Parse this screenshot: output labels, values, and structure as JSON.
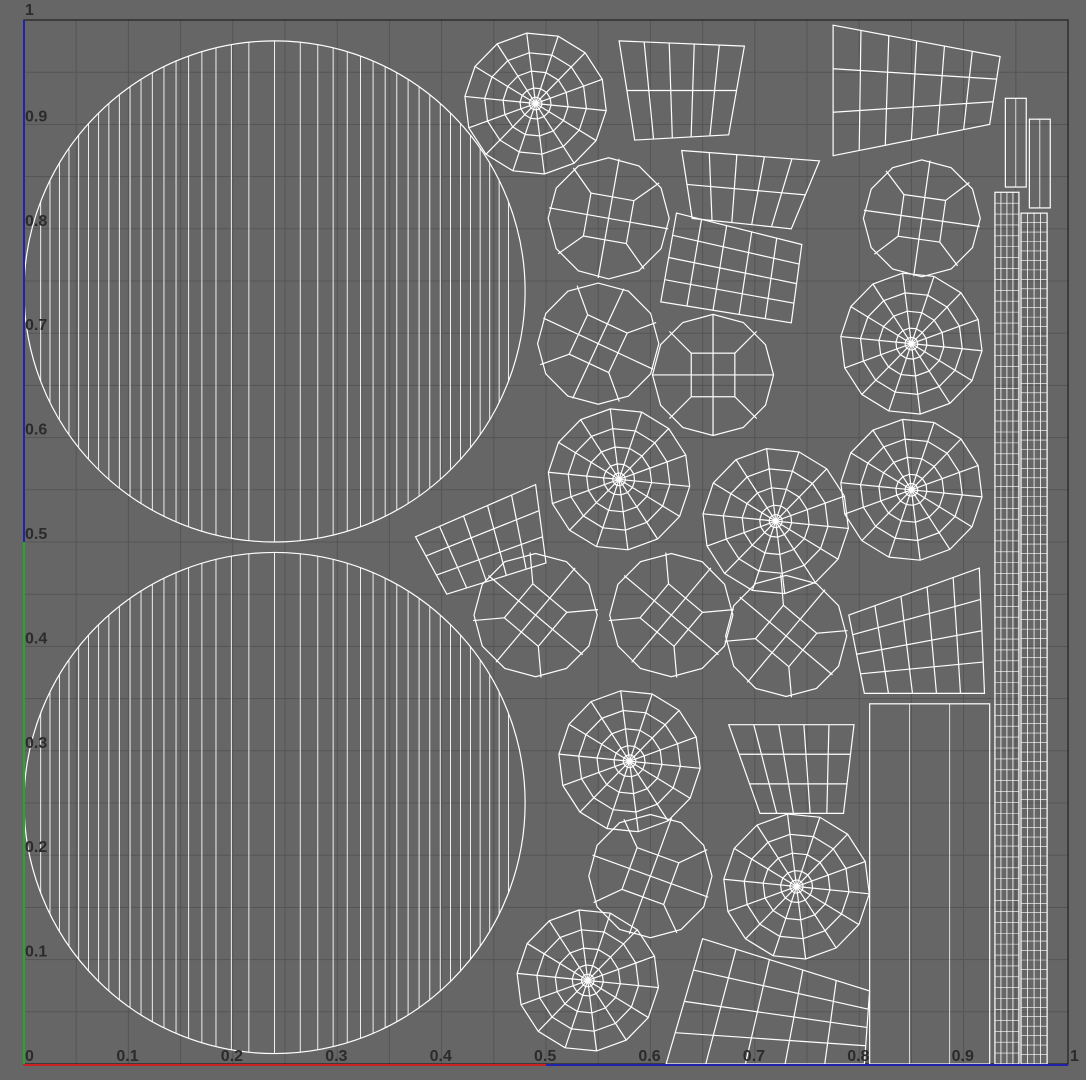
{
  "viewport": {
    "background": "#666666",
    "grid_color": "#555555",
    "line_color": "#ffffff",
    "border_color": "#222222",
    "u_axis_color": "#cc2222",
    "v_axis_color": "#2222aa",
    "v_axis_lower_color": "#22aa22"
  },
  "axes": {
    "u_ticks": [
      "0",
      "0.1",
      "0.2",
      "0.3",
      "0.4",
      "0.5",
      "0.6",
      "0.7",
      "0.8",
      "0.9",
      "1"
    ],
    "v_ticks": [
      "0.1",
      "0.2",
      "0.3",
      "0.4",
      "0.5",
      "0.6",
      "0.7",
      "0.8",
      "0.9",
      "1"
    ]
  },
  "uv_islands": {
    "large_disks": [
      {
        "name": "uv-island-large-disk-top",
        "u": 0.24,
        "v": 0.74,
        "r": 0.24,
        "stripes": 40
      },
      {
        "name": "uv-island-large-disk-bottom",
        "u": 0.24,
        "v": 0.25,
        "r": 0.24,
        "stripes": 40
      }
    ],
    "radial_caps": [
      {
        "name": "uv-island-cap-1",
        "u": 0.49,
        "v": 0.92,
        "r": 0.068,
        "sides": 14
      },
      {
        "name": "uv-island-cap-2",
        "u": 0.57,
        "v": 0.56,
        "r": 0.068,
        "sides": 14
      },
      {
        "name": "uv-island-cap-3",
        "u": 0.72,
        "v": 0.52,
        "r": 0.07,
        "sides": 14
      },
      {
        "name": "uv-island-cap-4",
        "u": 0.85,
        "v": 0.69,
        "r": 0.068,
        "sides": 14
      },
      {
        "name": "uv-island-cap-5",
        "u": 0.85,
        "v": 0.55,
        "r": 0.068,
        "sides": 14
      },
      {
        "name": "uv-island-cap-6",
        "u": 0.58,
        "v": 0.29,
        "r": 0.068,
        "sides": 14
      },
      {
        "name": "uv-island-cap-7",
        "u": 0.74,
        "v": 0.17,
        "r": 0.07,
        "sides": 14
      },
      {
        "name": "uv-island-cap-8",
        "u": 0.54,
        "v": 0.08,
        "r": 0.068,
        "sides": 14
      }
    ],
    "quad_caps": [
      {
        "name": "uv-island-quad-cap-1",
        "u": 0.56,
        "v": 0.81,
        "r": 0.058,
        "rot": 10
      },
      {
        "name": "uv-island-quad-cap-2",
        "u": 0.55,
        "v": 0.69,
        "r": 0.058,
        "rot": 25
      },
      {
        "name": "uv-island-quad-cap-3",
        "u": 0.66,
        "v": 0.66,
        "r": 0.058,
        "rot": 0
      },
      {
        "name": "uv-island-quad-cap-4",
        "u": 0.86,
        "v": 0.81,
        "r": 0.056,
        "rot": 8
      },
      {
        "name": "uv-island-quad-cap-5",
        "u": 0.49,
        "v": 0.43,
        "r": 0.059,
        "rot": 40
      },
      {
        "name": "uv-island-quad-cap-6",
        "u": 0.62,
        "v": 0.43,
        "r": 0.059,
        "rot": 40
      },
      {
        "name": "uv-island-quad-cap-7",
        "u": 0.73,
        "v": 0.41,
        "r": 0.058,
        "rot": 40
      },
      {
        "name": "uv-island-quad-cap-8",
        "u": 0.6,
        "v": 0.18,
        "r": 0.059,
        "rot": 20
      }
    ],
    "ring_strips": [
      {
        "name": "uv-island-strip-1",
        "pts": [
          [
            0.57,
            0.98
          ],
          [
            0.69,
            0.975
          ],
          [
            0.675,
            0.89
          ],
          [
            0.585,
            0.885
          ]
        ],
        "cols": 5,
        "rows": 2
      },
      {
        "name": "uv-island-strip-2",
        "pts": [
          [
            0.775,
            0.995
          ],
          [
            0.935,
            0.965
          ],
          [
            0.925,
            0.9
          ],
          [
            0.775,
            0.87
          ]
        ],
        "cols": 6,
        "rows": 3
      },
      {
        "name": "uv-island-strip-3",
        "pts": [
          [
            0.63,
            0.875
          ],
          [
            0.762,
            0.865
          ],
          [
            0.735,
            0.8
          ],
          [
            0.64,
            0.81
          ]
        ],
        "cols": 5,
        "rows": 2
      },
      {
        "name": "uv-island-strip-4",
        "pts": [
          [
            0.625,
            0.815
          ],
          [
            0.745,
            0.785
          ],
          [
            0.735,
            0.71
          ],
          [
            0.61,
            0.73
          ]
        ],
        "cols": 5,
        "rows": 4
      },
      {
        "name": "uv-island-strip-5",
        "pts": [
          [
            0.375,
            0.505
          ],
          [
            0.49,
            0.555
          ],
          [
            0.5,
            0.48
          ],
          [
            0.405,
            0.45
          ]
        ],
        "cols": 5,
        "rows": 3
      },
      {
        "name": "uv-island-strip-6",
        "pts": [
          [
            0.79,
            0.43
          ],
          [
            0.915,
            0.475
          ],
          [
            0.92,
            0.355
          ],
          [
            0.805,
            0.355
          ]
        ],
        "cols": 5,
        "rows": 4
      },
      {
        "name": "uv-island-strip-7",
        "pts": [
          [
            0.675,
            0.325
          ],
          [
            0.795,
            0.325
          ],
          [
            0.785,
            0.24
          ],
          [
            0.705,
            0.24
          ]
        ],
        "cols": 5,
        "rows": 3
      },
      {
        "name": "uv-island-strip-8",
        "pts": [
          [
            0.65,
            0.12
          ],
          [
            0.81,
            0.07
          ],
          [
            0.805,
            0.0
          ],
          [
            0.615,
            0.0
          ]
        ],
        "cols": 5,
        "rows": 4
      }
    ],
    "grid_panels": [
      {
        "name": "uv-island-wide-panel",
        "u0": 0.81,
        "v0": 0.0,
        "u1": 0.925,
        "v1": 0.345,
        "cols": 3,
        "rows": 1
      },
      {
        "name": "uv-island-long-strip-a",
        "u0": 0.93,
        "v0": 0.0,
        "u1": 0.953,
        "v1": 0.835,
        "cols": 4,
        "rows": 80
      },
      {
        "name": "uv-island-long-strip-b",
        "u0": 0.955,
        "v0": 0.0,
        "u1": 0.98,
        "v1": 0.815,
        "cols": 4,
        "rows": 90
      },
      {
        "name": "uv-island-small-bar-a",
        "u0": 0.94,
        "v0": 0.84,
        "u1": 0.96,
        "v1": 0.925,
        "cols": 2,
        "rows": 1
      },
      {
        "name": "uv-island-small-bar-b",
        "u0": 0.963,
        "v0": 0.82,
        "u1": 0.983,
        "v1": 0.905,
        "cols": 2,
        "rows": 1
      }
    ]
  }
}
